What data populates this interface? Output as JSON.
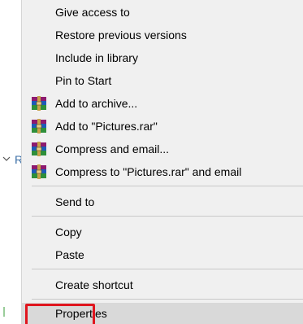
{
  "background": {
    "partial_label": "R"
  },
  "menu": {
    "items": [
      {
        "label": "Give access to",
        "icon": null
      },
      {
        "label": "Restore previous versions",
        "icon": null
      },
      {
        "label": "Include in library",
        "icon": null
      },
      {
        "label": "Pin to Start",
        "icon": null
      },
      {
        "label": "Add to archive...",
        "icon": "winrar-icon"
      },
      {
        "label": "Add to \"Pictures.rar\"",
        "icon": "winrar-icon"
      },
      {
        "label": "Compress and email...",
        "icon": "winrar-icon"
      },
      {
        "label": "Compress to \"Pictures.rar\" and email",
        "icon": "winrar-icon"
      },
      {
        "label": "Send to",
        "icon": null
      },
      {
        "label": "Copy",
        "icon": null
      },
      {
        "label": "Paste",
        "icon": null
      },
      {
        "label": "Create shortcut",
        "icon": null
      },
      {
        "label": "Properties",
        "icon": null
      }
    ],
    "highlighted_item": "Properties",
    "colors": {
      "menu_background": "#f0f0f0",
      "separator": "#c9c9c9",
      "hover_background": "#d9d9d9",
      "highlight_border": "#e0151e"
    }
  }
}
